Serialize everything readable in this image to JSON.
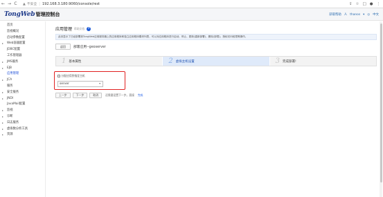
{
  "browser": {
    "nav": {
      "back": "←",
      "forward": "→",
      "reload": "C"
    },
    "security_warning": "▲",
    "insecure_label": "不安全",
    "separator": "|",
    "url": "192.168.3.180:9060/console/rest",
    "icons": {
      "share": "⇪",
      "star": "☆",
      "tab": "□",
      "profile": "●",
      "menu": "⋮"
    }
  },
  "header": {
    "logo": "TongWeb",
    "title": "管理控制台",
    "help": "获取帮助",
    "user": "thanos",
    "user_caret": "▾",
    "language": "中文",
    "user_icon": "人",
    "lang_icon": "◎"
  },
  "sidebar": {
    "items": [
      {
        "label": "首页",
        "grp": false,
        "arr": ""
      },
      {
        "label": "监视概况",
        "grp": false,
        "arr": ""
      },
      {
        "label": "启动参数配置",
        "grp": false,
        "arr": ""
      },
      {
        "label": "Web容器配置",
        "grp": true,
        "arr": "▸"
      },
      {
        "label": "JDBC配置",
        "grp": false,
        "arr": ""
      },
      {
        "label": "工作管理器",
        "grp": false,
        "arr": ""
      },
      {
        "label": "JMS服务",
        "grp": true,
        "arr": "▸"
      },
      {
        "label": "EJB",
        "grp": true,
        "arr": "▸"
      },
      {
        "label": "应用管理",
        "grp": false,
        "arr": "",
        "active": true
      },
      {
        "label": "JCA",
        "grp": true,
        "arr": "▸"
      },
      {
        "label": "服务",
        "grp": false,
        "arr": ""
      },
      {
        "label": "安全服务",
        "grp": true,
        "arr": "▸"
      },
      {
        "label": "JNDI",
        "grp": true,
        "arr": "▸"
      },
      {
        "label": "JavaMail配置",
        "grp": false,
        "arr": ""
      },
      {
        "label": "监视",
        "grp": true,
        "arr": "▸"
      },
      {
        "label": "诊断",
        "grp": true,
        "arr": "▸"
      },
      {
        "label": "日志服务",
        "grp": true,
        "arr": "▸"
      },
      {
        "label": "虚拟数分析工具",
        "grp": true,
        "arr": "▸"
      },
      {
        "label": "资源",
        "grp": true,
        "arr": "▸"
      }
    ]
  },
  "main": {
    "title": "应用管理",
    "subtitle": "帮助文档",
    "help_icon": "?",
    "info": "此页显示了已经部署到TongWeb应用服务器上的应用程序和独立应用程序模块列表，可以对应用程序进行启动、停止、更新(重新部署)、删除(卸载)、授权访问权限等操作。",
    "back_button": "返回",
    "deploy_label": "部署应用--geoserver",
    "steps": [
      {
        "num": "1",
        "label": "基本属性",
        "active": false
      },
      {
        "num": "2",
        "label": "虚拟主机设置",
        "active": true
      },
      {
        "num": "3",
        "label": "完成部署!",
        "active": false
      }
    ],
    "target": {
      "label": "分配应用到指定主机",
      "value": "server",
      "caret": "▾"
    },
    "actions": {
      "prev": "上一步",
      "next": "下一步",
      "cancel": "取消",
      "hint": "还需要设置下一步。直接",
      "hint_link": "完成"
    }
  }
}
